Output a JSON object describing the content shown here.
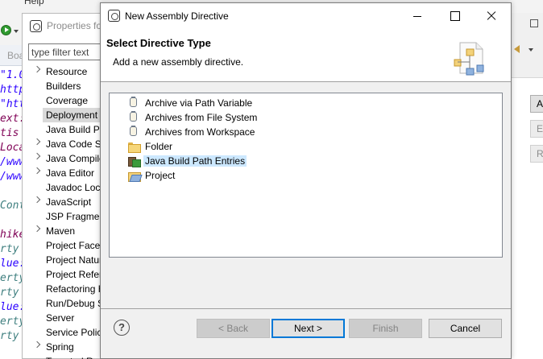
{
  "ide": {
    "menu_help": "Help",
    "editor_tab": "Boa",
    "code_lines": [
      {
        "text": "\"1.0",
        "color": "#2a00ff"
      },
      {
        "text": "http",
        "color": "#2a00ff"
      },
      {
        "text": "\"htt",
        "color": "#2a00ff"
      },
      {
        "text": "ext:",
        "color": "#7f0055"
      },
      {
        "text": "tis",
        "color": "#7f0055"
      },
      {
        "text": "Loca",
        "color": "#7f0055"
      },
      {
        "text": "/www",
        "color": "#2a00ff"
      },
      {
        "text": "/www",
        "color": "#2a00ff"
      },
      {
        "text": "",
        "color": "#000000"
      },
      {
        "text": "Cont",
        "color": "#3f7f7f"
      },
      {
        "text": "",
        "color": "#000000"
      },
      {
        "text": "hike",
        "color": "#7f0055"
      },
      {
        "text": "rty",
        "color": "#3f7f7f"
      },
      {
        "text": "lue:",
        "color": "#2a00ff"
      },
      {
        "text": "erty",
        "color": "#3f7f7f"
      },
      {
        "text": "rty",
        "color": "#3f7f7f"
      },
      {
        "text": "lue:",
        "color": "#2a00ff"
      },
      {
        "text": "erty",
        "color": "#3f7f7f"
      },
      {
        "text": "rty",
        "color": "#3f7f7f"
      }
    ]
  },
  "properties": {
    "title": "Properties fo",
    "filter_placeholder": "type filter text",
    "tree": [
      {
        "label": "Resource",
        "expandable": true,
        "selected": false
      },
      {
        "label": "Builders",
        "expandable": false,
        "selected": false
      },
      {
        "label": "Coverage",
        "expandable": false,
        "selected": false
      },
      {
        "label": "Deployment",
        "expandable": false,
        "selected": true
      },
      {
        "label": "Java Build Pa",
        "expandable": false,
        "selected": false
      },
      {
        "label": "Java Code St",
        "expandable": true,
        "selected": false
      },
      {
        "label": "Java Compile",
        "expandable": true,
        "selected": false
      },
      {
        "label": "Java Editor",
        "expandable": true,
        "selected": false
      },
      {
        "label": "Javadoc Loca",
        "expandable": false,
        "selected": false
      },
      {
        "label": "JavaScript",
        "expandable": true,
        "selected": false
      },
      {
        "label": "JSP Fragmen",
        "expandable": false,
        "selected": false
      },
      {
        "label": "Maven",
        "expandable": true,
        "selected": false
      },
      {
        "label": "Project Facet",
        "expandable": false,
        "selected": false
      },
      {
        "label": "Project Natur",
        "expandable": false,
        "selected": false
      },
      {
        "label": "Project Refer",
        "expandable": false,
        "selected": false
      },
      {
        "label": "Refactoring H",
        "expandable": false,
        "selected": false
      },
      {
        "label": "Run/Debug S",
        "expandable": false,
        "selected": false
      },
      {
        "label": "Server",
        "expandable": false,
        "selected": false
      },
      {
        "label": "Service Polic",
        "expandable": false,
        "selected": false
      },
      {
        "label": "Spring",
        "expandable": true,
        "selected": false
      },
      {
        "label": "Targeted Runtimes",
        "expandable": false,
        "selected": false
      }
    ]
  },
  "right_panel": {
    "buttons": [
      {
        "label": "Ad",
        "enabled": true
      },
      {
        "label": "Ed",
        "enabled": false
      },
      {
        "label": "Rer",
        "enabled": false
      }
    ]
  },
  "dialog": {
    "title": "New Assembly Directive",
    "header_title": "Select Directive Type",
    "header_description": "Add a new assembly directive.",
    "directive_types": [
      {
        "label": "Archive via Path Variable",
        "icon": "jar-icon",
        "selected": false
      },
      {
        "label": "Archives from File System",
        "icon": "jar-icon",
        "selected": false
      },
      {
        "label": "Archives from Workspace",
        "icon": "jar-icon",
        "selected": false
      },
      {
        "label": "Folder",
        "icon": "folder-icon",
        "selected": false
      },
      {
        "label": "Java Build Path Entries",
        "icon": "build-path-icon",
        "selected": true
      },
      {
        "label": "Project",
        "icon": "project-icon",
        "selected": false
      }
    ],
    "buttons": {
      "help": "?",
      "back": "< Back",
      "next": "Next >",
      "finish": "Finish",
      "cancel": "Cancel"
    },
    "colors": {
      "selection": "#cce8ff",
      "default_button_border": "#0078d7"
    }
  }
}
